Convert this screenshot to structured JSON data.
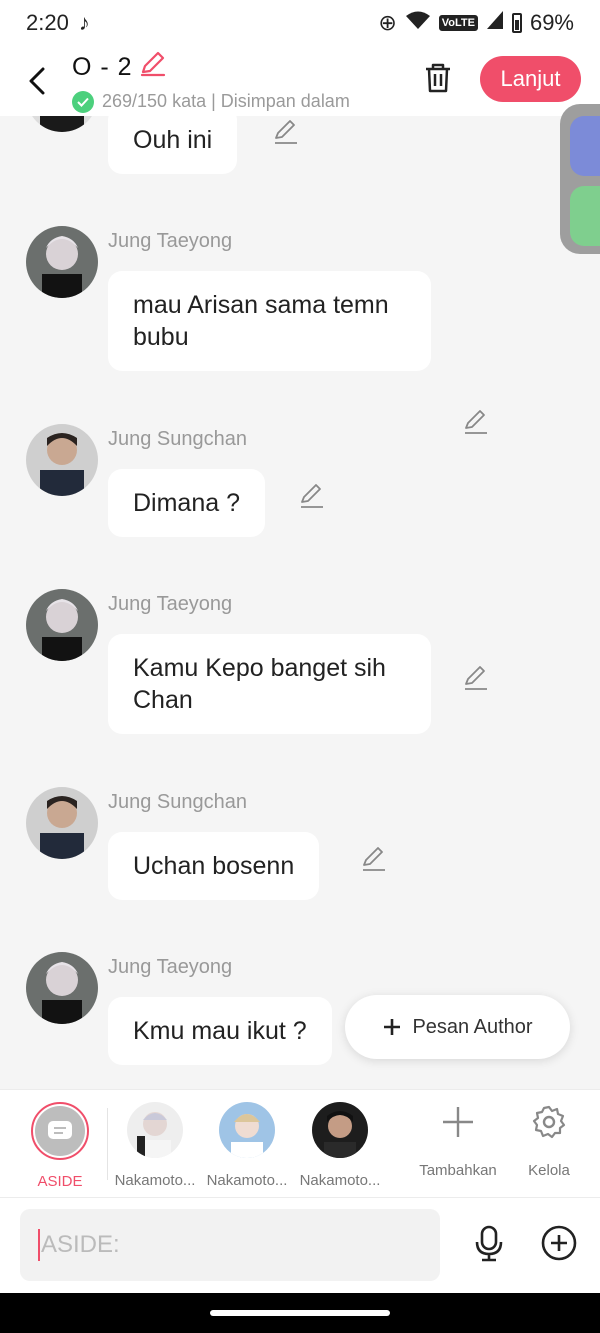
{
  "status": {
    "time": "2:20",
    "battery": "69%",
    "network": "VoLTE"
  },
  "header": {
    "title": "O - 2",
    "subtitle": "269/150 kata | Disimpan dalam",
    "next_label": "Lanjut"
  },
  "messages": [
    {
      "name": "",
      "text": "Ouh ini",
      "avatar": "taeyong"
    },
    {
      "name": "Jung Taeyong",
      "text": "mau Arisan sama temn bubu",
      "avatar": "taeyong"
    },
    {
      "name": "Jung Sungchan",
      "text": "Dimana ?",
      "avatar": "sungchan"
    },
    {
      "name": "Jung Taeyong",
      "text": "Kamu Kepo banget sih Chan",
      "avatar": "taeyong"
    },
    {
      "name": "Jung Sungchan",
      "text": "Uchan bosenn",
      "avatar": "sungchan"
    },
    {
      "name": "Jung Taeyong",
      "text": "Kmu mau ikut ?",
      "avatar": "taeyong"
    }
  ],
  "pesan_author": {
    "label": "Pesan Author"
  },
  "characters": [
    {
      "label": "ASIDE",
      "selected": true
    },
    {
      "label": "Nakamoto..."
    },
    {
      "label": "Nakamoto..."
    },
    {
      "label": "Nakamoto..."
    }
  ],
  "actions": {
    "add_label": "Tambahkan",
    "manage_label": "Kelola"
  },
  "input": {
    "placeholder": "ASIDE:"
  },
  "colors": {
    "accent": "#f04e6a",
    "check": "#4cd07d",
    "background": "#f5f5f5"
  },
  "icons": [
    "back-icon",
    "pencil-icon",
    "check-icon",
    "trash-icon",
    "edit-icon",
    "plus-icon",
    "gear-icon",
    "mic-icon",
    "plus-circle-icon",
    "chat-bubble-icon"
  ]
}
